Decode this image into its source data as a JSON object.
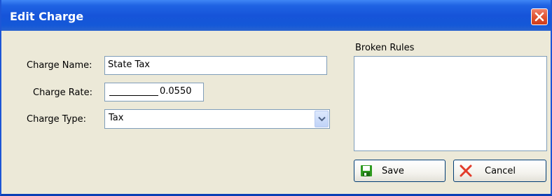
{
  "dialog": {
    "title": "Edit Charge"
  },
  "form": {
    "charge_name_label": "Charge Name:",
    "charge_name_value": "State Tax",
    "charge_rate_label": "Charge Rate:",
    "charge_rate_value": "0.0550",
    "charge_type_label": "Charge Type:",
    "charge_type_value": "Tax"
  },
  "broken_rules": {
    "label": "Broken Rules",
    "items": []
  },
  "buttons": {
    "save_label": "Save",
    "cancel_label": "Cancel"
  },
  "icons": {
    "close": "close-icon",
    "dropdown": "chevron-down-icon",
    "save": "floppy-disk-icon",
    "cancel": "x-mark-icon"
  },
  "colors": {
    "title_bar": "#1654d9",
    "window_bg": "#ece9d8",
    "close_red": "#e15432",
    "save_green": "#2e9a1f",
    "cancel_red": "#e23b2a"
  }
}
